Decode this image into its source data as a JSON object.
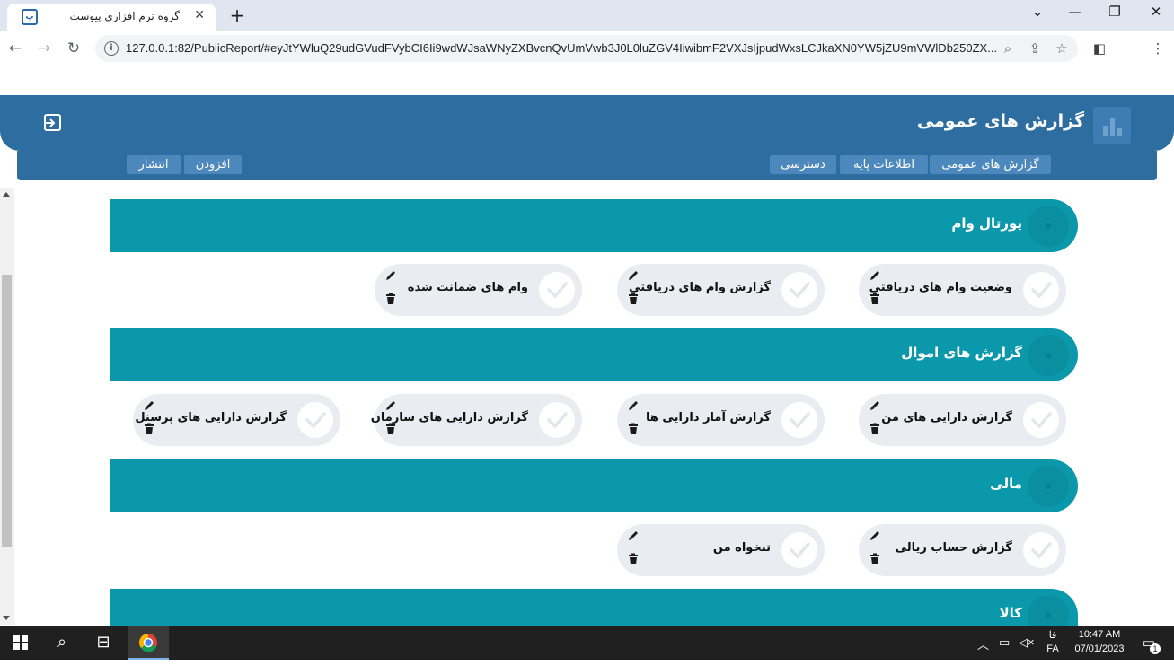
{
  "browser": {
    "tab_title": "گروه نرم افزاری پیوست",
    "tab_favicon": "پ",
    "url": "127.0.0.1:82/PublicReport/#eyJtYWluQ29udGVudFVybCI6Ii9wdWJsaWNyZXBvcnQvUmVwb3J0L0luZGV4IiwibmF2VXJsIjpudWxsLCJkaXN0YW5jZU9mVWlDb250ZX..."
  },
  "header": {
    "title": "گزارش های عمومی"
  },
  "menu": {
    "right": [
      "گزارش های عمومی",
      "اطلاعات پایه",
      "دسترسی"
    ],
    "left_add": "افزودن",
    "left_publish": "انتشار"
  },
  "sections": [
    {
      "title": "پورتال وام",
      "cards": [
        "وضعیت وام های دریافتی",
        "گزارش وام های دریافتی",
        "وام های ضمانت شده"
      ]
    },
    {
      "title": "گزارش های اموال",
      "cards": [
        "گزارش دارایی های من",
        "گزارش آمار دارایی ها",
        "گزارش دارایی های سازمان",
        "گزارش دارایی های پرسنل"
      ]
    },
    {
      "title": "مالی",
      "cards": [
        "گزارش حساب ریالی",
        "تنخواه من"
      ]
    },
    {
      "title": "کالا",
      "cards": []
    }
  ],
  "taskbar": {
    "lang_top": "فا",
    "lang_bottom": "FA",
    "time": "10:47 AM",
    "date": "07/01/2023",
    "notification_count": "1"
  },
  "colors": {
    "header": "#2e6da0",
    "section": "#0b98aa",
    "card": "#e9edf2"
  }
}
